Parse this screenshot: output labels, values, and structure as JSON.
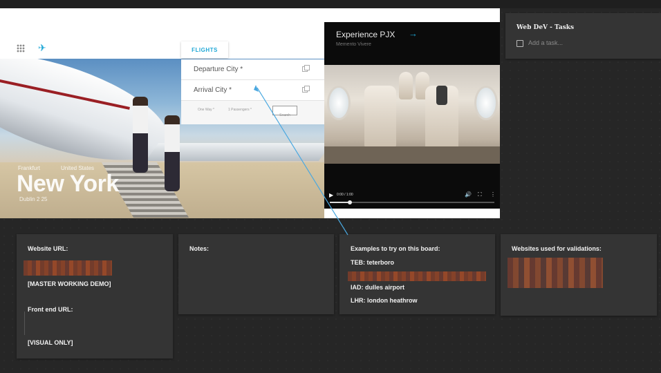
{
  "screenshot": {
    "tab_flights": "FLIGHTS",
    "departure_label": "Departure City *",
    "arrival_label": "Arrival City *",
    "one_way": "One Way *",
    "passengers": "1 Passengers *",
    "search_label": "Search",
    "hero_from": "Frankfurt",
    "hero_country": "United States",
    "hero_city": "New York",
    "hero_code": "Dublin 2 25",
    "video_title": "Experience PJX",
    "video_subtitle": "Memento Vivere",
    "video_time": "0:00 / 1:00",
    "video_progress": 0.12
  },
  "tasks": {
    "title": "Web DeV - Tasks",
    "placeholder": "Add a task..."
  },
  "cards": {
    "website": {
      "title": "Website URL:",
      "master": "[MASTER  WORKING DEMO]",
      "frontend": "Front end URL:",
      "visual": "[VISUAL ONLY]"
    },
    "notes": {
      "title": "Notes:"
    },
    "examples": {
      "title": "Examples to try on this board:",
      "teb": "TEB: teterboro",
      "iad": "IAD: dulles airport",
      "lhr": "LHR: london heathrow"
    },
    "validations": {
      "title": "Websites used for validations:"
    }
  },
  "colors": {
    "accent": "#1ea7d6",
    "board_bg": "#262626",
    "card_bg": "#343434"
  }
}
